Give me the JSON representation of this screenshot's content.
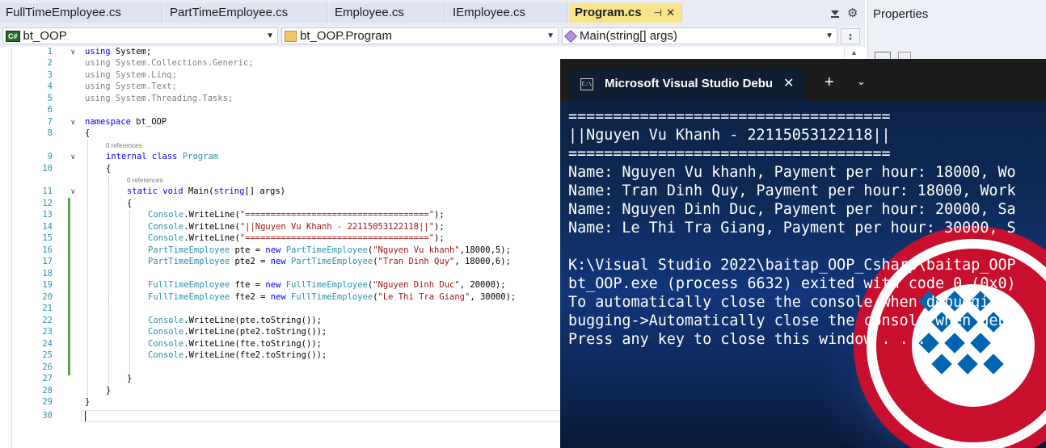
{
  "tabs": [
    {
      "label": "FullTimeEmployee.cs"
    },
    {
      "label": "PartTimeEmployee.cs"
    },
    {
      "label": "Employee.cs"
    },
    {
      "label": "IEmployee.cs"
    },
    {
      "label": "Program.cs",
      "active": true,
      "pin_icon": "pin-icon",
      "close_icon": "close-icon"
    }
  ],
  "properties": {
    "title": "Properties"
  },
  "navbar": {
    "project": "bt_OOP",
    "class": "bt_OOP.Program",
    "member": "Main(string[] args)",
    "project_badge": "C#"
  },
  "editor": {
    "line_numbers": [
      "1",
      "2",
      "3",
      "4",
      "5",
      "6",
      "7",
      "8",
      "9",
      "10",
      "11",
      "12",
      "13",
      "14",
      "15",
      "16",
      "17",
      "18",
      "19",
      "20",
      "21",
      "22",
      "23",
      "24",
      "25",
      "26",
      "27",
      "28",
      "29",
      "30"
    ],
    "references": [
      "0 references",
      "0 references"
    ],
    "code": {
      "l1_kw": "using",
      "l1_rest": " System;",
      "l2": "using System.Collections.Generic;",
      "l3": "using System.Linq;",
      "l4": "using System.Text;",
      "l5": "using System.Threading.Tasks;",
      "l7_kw": "namespace",
      "l7_rest": " bt_OOP",
      "open_brace": "{",
      "close_brace": "}",
      "l9_kw": "internal class",
      "l9_type": " Program",
      "l11_kw": "static void",
      "l11_m": " Main(",
      "l11_kw2": "string",
      "l11_rest": "[] args)",
      "console": "Console",
      "writeline": ".WriteLine(",
      "l13_str": "\"====================================\"",
      "l14_str": "\"||Nguyen Vu Khanh - 22115053122118||\"",
      "end": ");",
      "pte_type": "PartTimeEmployee",
      "fte_type": "FullTimeEmployee",
      "new_kw": "new",
      "l16_var": " pte = ",
      "l16_str": "\"Nguyen Vu khanh\"",
      "l16_args": ",18000,5);",
      "l17_var": " pte2 = ",
      "l17_str": "\"Tran Dinh Quy\"",
      "l17_args": ", 18000,6);",
      "l19_var": " fte = ",
      "l19_str": "\"Nguyen Dinh Duc\"",
      "l19_args": ", 20000);",
      "l20_var": " fte2 = ",
      "l20_str": "\"Le Thi Tra Giang\"",
      "l20_args": ", 30000);",
      "l22_arg": "pte.toString());",
      "l23_arg": "pte2.toString());",
      "l24_arg": "fte.toString());",
      "l25_arg": "fte2.toString());"
    }
  },
  "console": {
    "title": "Microsoft Visual Studio Debug",
    "lines": [
      "====================================",
      "||Nguyen Vu Khanh - 22115053122118||",
      "====================================",
      "Name: Nguyen Vu khanh, Payment per hour: 18000, Wo",
      "Name: Tran Dinh Quy, Payment per hour: 18000, Work",
      "Name: Nguyen Dinh Duc, Payment per hour: 20000, Sa",
      "Name: Le Thi Tra Giang, Payment per hour: 30000, S",
      "",
      "K:\\Visual Studio 2022\\baitap_OOP_Csharp\\baitap_OOP",
      "bt_OOP.exe (process 6632) exited with code 0 (0x0)",
      "To automatically close the console when debugging",
      "bugging->Automatically close the console when debu",
      "Press any key to close this window . . ."
    ]
  },
  "colors": {
    "accent_tab": "#f9e48a",
    "keyword": "#0000ff",
    "type": "#2b91af",
    "string": "#a31515",
    "change_bar": "#57a64a"
  }
}
